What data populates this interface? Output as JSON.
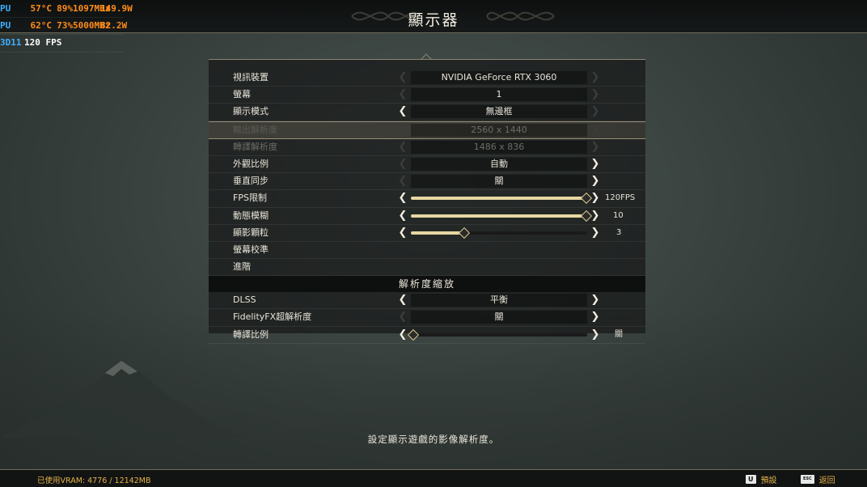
{
  "window": {
    "title": "顯示器"
  },
  "hud": [
    {
      "a": "PU",
      "b": "57",
      "bu": "°C",
      "c": "89",
      "cu": "%",
      "d": "1097",
      "du": "MHz",
      "e": "149.9",
      "eu": "W"
    },
    {
      "a": "PU",
      "b": "62",
      "bu": "°C",
      "c": "73",
      "cu": "%",
      "d": "5000",
      "du": "MHz",
      "e": "82.2",
      "eu": "W"
    },
    {
      "a": "3D11",
      "b": "120",
      "bu": "FPS"
    }
  ],
  "settings": {
    "video_device": {
      "label": "視訊裝置",
      "value": "NVIDIA GeForce RTX 3060"
    },
    "monitor": {
      "label": "螢幕",
      "value": "1"
    },
    "display_mode": {
      "label": "顯示模式",
      "value": "無邊框"
    },
    "output_resolution": {
      "label": "輸出解析度",
      "value": "2560 x 1440"
    },
    "render_resolution": {
      "label": "轉譯解析度",
      "value": "1486 x 836"
    },
    "aspect_ratio": {
      "label": "外觀比例",
      "value": "自動"
    },
    "vsync": {
      "label": "垂直同步",
      "value": "關"
    },
    "fps_limit": {
      "label": "FPS限制",
      "value": "120FPS",
      "level": 1.0
    },
    "motion_blur": {
      "label": "動態模糊",
      "value": "10",
      "level": 1.0
    },
    "film_grain": {
      "label": "顯影顆粒",
      "value": "3",
      "level": 0.3
    },
    "calibration": {
      "label": "螢幕校準"
    },
    "advanced": {
      "label": "進階"
    }
  },
  "scaling": {
    "section_title": "解析度縮放",
    "dlss": {
      "label": "DLSS",
      "value": "平衡"
    },
    "fsr": {
      "label": "FidelityFX超解析度",
      "value": "關"
    },
    "render_scale": {
      "label": "轉譯比例",
      "value": "關",
      "level": 0.0
    }
  },
  "hint": "設定顯示遊戲的影像解析度。",
  "footer": {
    "vram": "已使用VRAM: 4776 / 12142MB",
    "default_key": "U",
    "default_label": "預設",
    "back_key": "ESC",
    "back_label": "返回"
  },
  "colors": {
    "accent": "#e3b14a",
    "slider_fill": "#e7d7a2",
    "hud_blue": "#3fb0ff",
    "hud_orange": "#ff8c1a"
  }
}
